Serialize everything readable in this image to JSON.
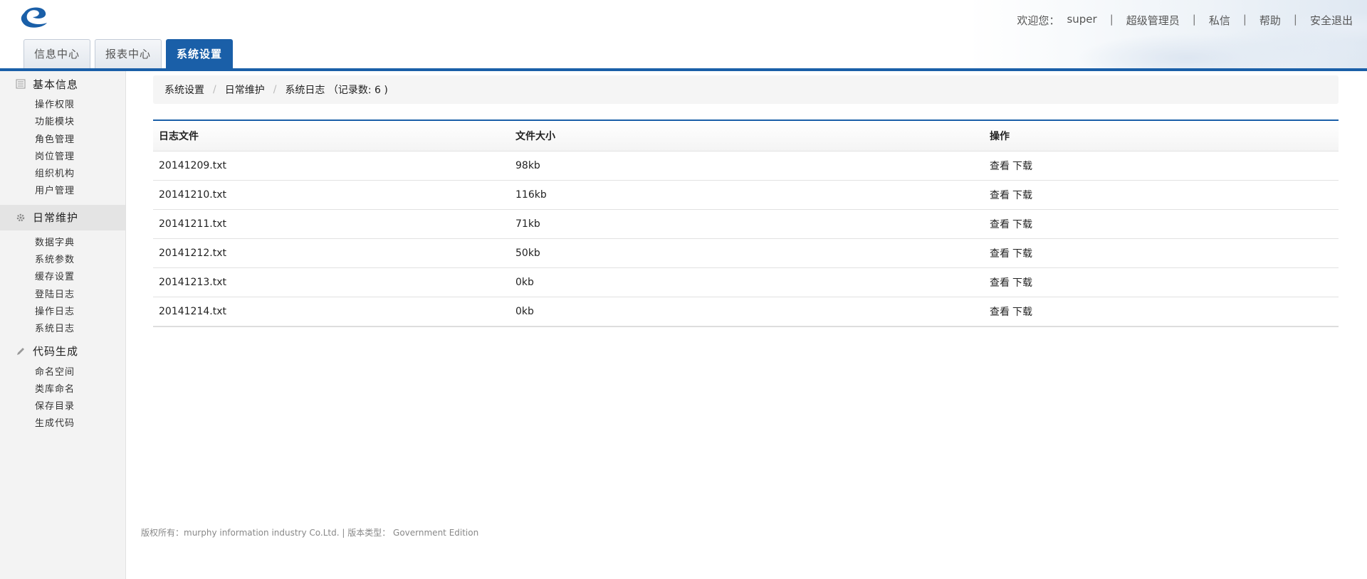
{
  "header": {
    "logo_icon": "cloud-swirl-logo-icon",
    "welcome_label": "欢迎您：",
    "username": "super",
    "role": "超级管理员",
    "links": {
      "messages": "私信",
      "help": "帮助",
      "logout": "安全退出"
    },
    "separator": "|"
  },
  "tabs": [
    {
      "label": "信息中心",
      "active": false
    },
    {
      "label": "报表中心",
      "active": false
    },
    {
      "label": "系统设置",
      "active": true
    }
  ],
  "sidebar": {
    "groups": [
      {
        "label": "基本信息",
        "icon": "list-icon",
        "items": [
          "操作权限",
          "功能模块",
          "角色管理",
          "岗位管理",
          "组织机构",
          "用户管理"
        ]
      },
      {
        "label": "日常维护",
        "icon": "gear-icon",
        "active": true,
        "items": [
          "数据字典",
          "系统参数",
          "缓存设置",
          "登陆日志",
          "操作日志",
          "系统日志"
        ]
      },
      {
        "label": "代码生成",
        "icon": "pencil-icon",
        "items": [
          "命名空间",
          "类库命名",
          "保存目录",
          "生成代码"
        ]
      }
    ]
  },
  "breadcrumb": {
    "items": [
      "系统设置",
      "日常维护"
    ],
    "current": "系统日志 （记录数: 6 )",
    "separator": "/"
  },
  "table": {
    "columns": [
      "日志文件",
      "文件大小",
      "操作"
    ],
    "rows": [
      {
        "file": "20141209.txt",
        "size": "98kb"
      },
      {
        "file": "20141210.txt",
        "size": "116kb"
      },
      {
        "file": "20141211.txt",
        "size": "71kb"
      },
      {
        "file": "20141212.txt",
        "size": "50kb"
      },
      {
        "file": "20141213.txt",
        "size": "0kb"
      },
      {
        "file": "20141214.txt",
        "size": "0kb"
      }
    ],
    "actions": {
      "view": "查看",
      "download": "下载"
    }
  },
  "footer": {
    "text": "版权所有：murphy information industry Co.Ltd. | 版本类型： Government Edition"
  },
  "colors": {
    "accent": "#1a5fa8",
    "sidebar_bg": "#f3f3f3"
  }
}
